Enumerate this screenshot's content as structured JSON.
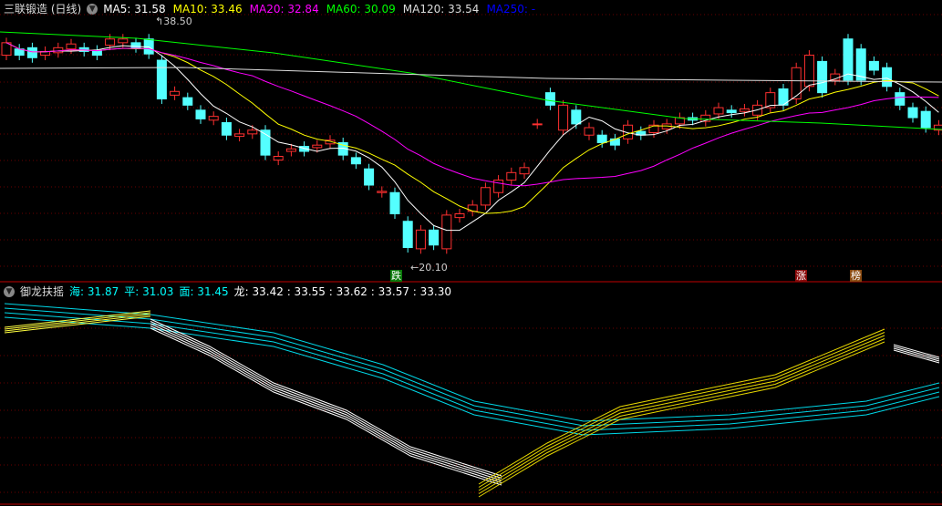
{
  "main": {
    "title": "三联锻造 (日线)",
    "ma": [
      {
        "label": "MA5: 31.58",
        "color": "#ffffff"
      },
      {
        "label": "MA10: 33.46",
        "color": "#ffff00"
      },
      {
        "label": "MA20: 32.84",
        "color": "#ff00ff"
      },
      {
        "label": "MA60: 30.09",
        "color": "#00ff00"
      },
      {
        "label": "MA120: 33.54",
        "color": "#dddddd"
      },
      {
        "label": "MA250: -",
        "color": "#0000ff"
      }
    ],
    "high_label": "38.50",
    "low_label": "20.10",
    "tags": {
      "down": "跌",
      "up": "涨",
      "rank": "榜"
    },
    "oc": [
      [
        37,
        38
      ],
      [
        37.5,
        37
      ],
      [
        37.6,
        36.8
      ],
      [
        37,
        37.3
      ],
      [
        37.2,
        37.6
      ],
      [
        37.5,
        37.9
      ],
      [
        37.6,
        37.3
      ],
      [
        37.4,
        37
      ],
      [
        37.8,
        38.3
      ],
      [
        38,
        38.3
      ],
      [
        38,
        37.6
      ],
      [
        38.3,
        37.1
      ],
      [
        36.6,
        33.5
      ],
      [
        33.8,
        34.1
      ],
      [
        33.6,
        33
      ],
      [
        32.6,
        31.9
      ],
      [
        31.8,
        32.1
      ],
      [
        31.6,
        30.6
      ],
      [
        30.5,
        30.7
      ],
      [
        30.7,
        31
      ],
      [
        31,
        29
      ],
      [
        28.6,
        28.9
      ],
      [
        29.3,
        29.5
      ],
      [
        29.7,
        29.3
      ],
      [
        29.6,
        29.8
      ],
      [
        29.9,
        30.2
      ],
      [
        30,
        29
      ],
      [
        28.8,
        28.3
      ],
      [
        27.9,
        26.6
      ],
      [
        26,
        26.1
      ],
      [
        26,
        24.3
      ],
      [
        23.7,
        21.6
      ],
      [
        21.5,
        23
      ],
      [
        23,
        21.8
      ],
      [
        21.5,
        24.2
      ],
      [
        24,
        24.3
      ],
      [
        24.5,
        25
      ],
      [
        25,
        26.4
      ],
      [
        26,
        27
      ],
      [
        27,
        27.6
      ],
      [
        27.5,
        28
      ],
      [
        31.5,
        31.5
      ],
      [
        34,
        33
      ],
      [
        31,
        33
      ],
      [
        32.6,
        31.5
      ],
      [
        30.6,
        31.2
      ],
      [
        30.6,
        30
      ],
      [
        30.3,
        29.8
      ],
      [
        30.3,
        31.4
      ],
      [
        30.9,
        30.6
      ],
      [
        30.8,
        31.4
      ],
      [
        31.1,
        31.5
      ],
      [
        31.5,
        32
      ],
      [
        32,
        31.8
      ],
      [
        31.7,
        32.2
      ],
      [
        32.3,
        32.8
      ],
      [
        32.6,
        32.4
      ],
      [
        32.5,
        32.7
      ],
      [
        32.2,
        33
      ],
      [
        32.8,
        34
      ],
      [
        34.3,
        33
      ],
      [
        33.5,
        36
      ],
      [
        34.5,
        37
      ],
      [
        36.5,
        34
      ],
      [
        35,
        35.5
      ],
      [
        38.3,
        35
      ],
      [
        37.5,
        35
      ],
      [
        36.5,
        35.8
      ],
      [
        36,
        34.5
      ],
      [
        34,
        33
      ],
      [
        32.8,
        32
      ],
      [
        32.5,
        31.2
      ],
      [
        31,
        31.4
      ]
    ]
  },
  "indicator": {
    "title": "御龙扶摇",
    "hai": "海: 31.87",
    "ping": "平: 31.03",
    "mian": "面: 31.45",
    "long": "龙: 33.42 : 33.55 : 33.62 : 33.57 : 33.30"
  }
}
